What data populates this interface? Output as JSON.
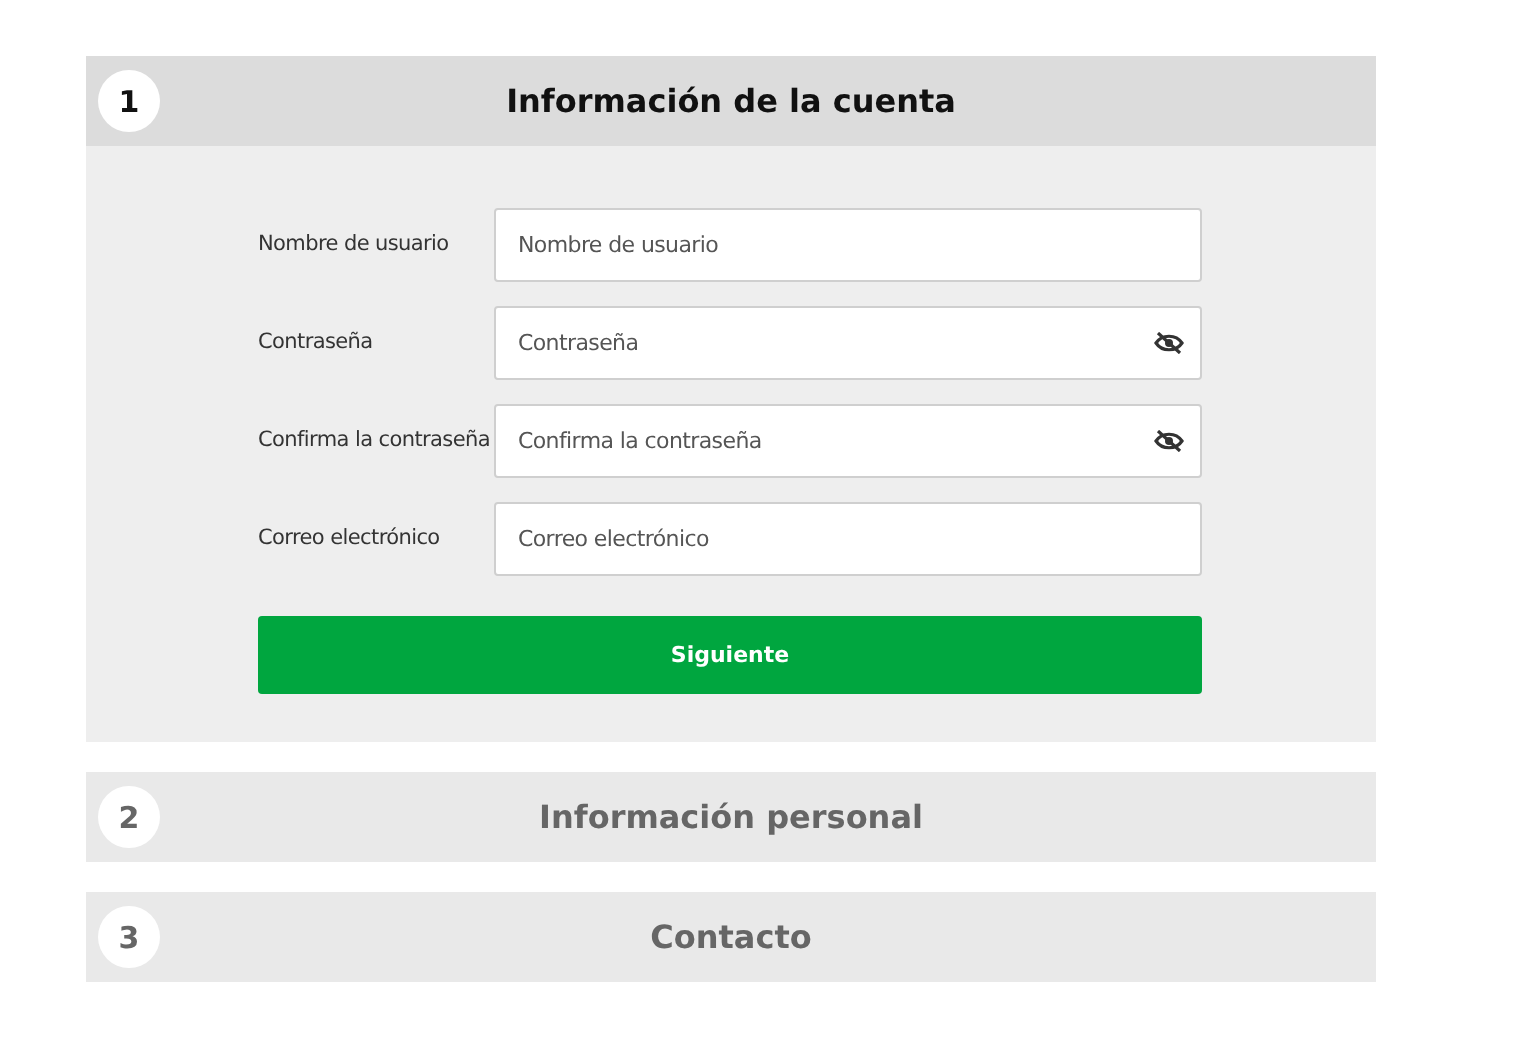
{
  "steps": [
    {
      "number": "1",
      "title": "Información de la cuenta",
      "expanded": true,
      "fields": [
        {
          "label": "Nombre de usuario",
          "placeholder": "Nombre de usuario",
          "kind": "text"
        },
        {
          "label": "Contraseña",
          "placeholder": "Contraseña",
          "kind": "password"
        },
        {
          "label": "Confirma la contraseña",
          "placeholder": "Confirma la contraseña",
          "kind": "password"
        },
        {
          "label": "Correo electrónico",
          "placeholder": "Correo electrónico",
          "kind": "text"
        }
      ],
      "button": "Siguiente"
    },
    {
      "number": "2",
      "title": "Información personal",
      "expanded": false
    },
    {
      "number": "3",
      "title": "Contacto",
      "expanded": false
    }
  ]
}
